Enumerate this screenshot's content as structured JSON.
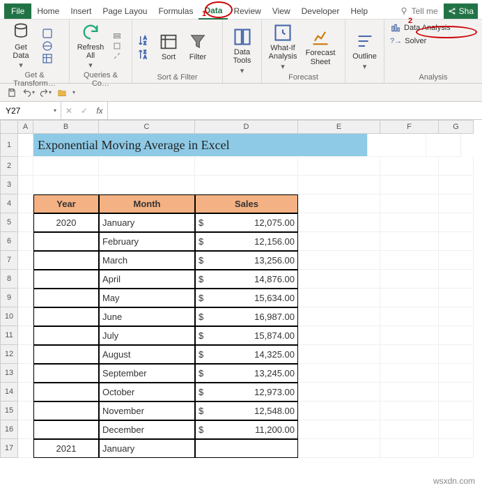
{
  "tabs": {
    "file": "File",
    "items": [
      "Home",
      "Insert",
      "Page Layou",
      "Formulas",
      "Data",
      "Review",
      "View",
      "Developer",
      "Help"
    ],
    "active_index": 4,
    "tell_me": "Tell me",
    "share": "Sha"
  },
  "annotations": {
    "one": "1",
    "two": "2"
  },
  "ribbon": {
    "get_data": "Get\nData",
    "refresh_all": "Refresh\nAll",
    "sort": "Sort",
    "filter": "Filter",
    "data_tools": "Data\nTools",
    "whatif": "What-If\nAnalysis",
    "forecast_sheet": "Forecast\nSheet",
    "outline": "Outline",
    "data_analysis": "Data Analysis",
    "solver": "Solver",
    "groups": {
      "g1": "Get & Transform…",
      "g2": "Queries & Co…",
      "g3": "Sort & Filter",
      "g4": "",
      "g5": "Forecast",
      "g6": "",
      "g7": "Analysis"
    }
  },
  "namebox": "Y27",
  "fx_label": "fx",
  "title": "Exponential Moving Average in Excel",
  "headers": {
    "year": "Year",
    "month": "Month",
    "sales": "Sales"
  },
  "row_nums": [
    "1",
    "2",
    "3",
    "4",
    "5",
    "6",
    "7",
    "8",
    "9",
    "10",
    "11",
    "12",
    "13",
    "14",
    "15",
    "16",
    "17"
  ],
  "col_heads": [
    "A",
    "B",
    "C",
    "D",
    "E",
    "F",
    "G"
  ],
  "table": [
    {
      "year": "2020",
      "month": "January",
      "sales": "12,075.00"
    },
    {
      "year": "",
      "month": "February",
      "sales": "12,156.00"
    },
    {
      "year": "",
      "month": "March",
      "sales": "13,256.00"
    },
    {
      "year": "",
      "month": "April",
      "sales": "14,876.00"
    },
    {
      "year": "",
      "month": "May",
      "sales": "15,634.00"
    },
    {
      "year": "",
      "month": "June",
      "sales": "16,987.00"
    },
    {
      "year": "",
      "month": "July",
      "sales": "15,874.00"
    },
    {
      "year": "",
      "month": "August",
      "sales": "14,325.00"
    },
    {
      "year": "",
      "month": "September",
      "sales": "13,245.00"
    },
    {
      "year": "",
      "month": "October",
      "sales": "12,973.00"
    },
    {
      "year": "",
      "month": "November",
      "sales": "12,548.00"
    },
    {
      "year": "",
      "month": "December",
      "sales": "11,200.00"
    },
    {
      "year": "2021",
      "month": "January",
      "sales": ""
    }
  ],
  "currency": "$",
  "watermark": "wsxdn.com"
}
